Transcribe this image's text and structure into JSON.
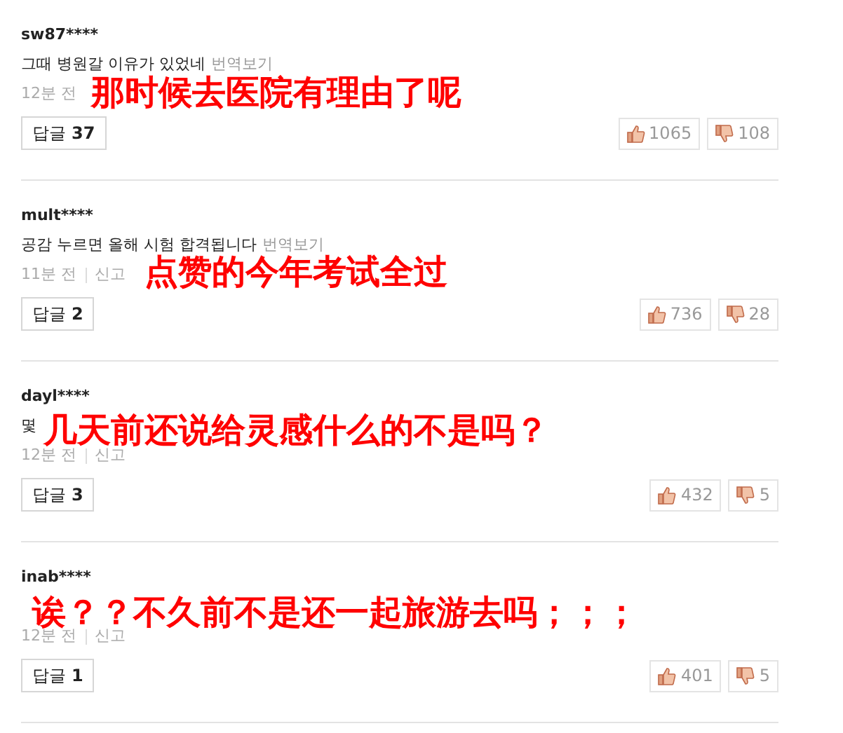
{
  "comments": [
    {
      "user": "sw87****",
      "text": "그때 병원갈 이유가 있었네",
      "translate": "번역보기",
      "time": "12분 전",
      "reply_label": "답글",
      "reply_count": "37",
      "likes": "1065",
      "dislikes": "108",
      "overlay": "那时候去医院有理由了呢"
    },
    {
      "user": "mult****",
      "text": "공감 누르면 올해 시험 합격됩니다",
      "translate": "번역보기",
      "time": "11분 전",
      "report": "신고",
      "reply_label": "답글",
      "reply_count": "2",
      "likes": "736",
      "dislikes": "28",
      "overlay": "点赞的今年考试全过"
    },
    {
      "user": "dayl****",
      "text": "몇",
      "time": "12분 전",
      "report": "신고",
      "reply_label": "답글",
      "reply_count": "3",
      "likes": "432",
      "dislikes": "5",
      "overlay": "几天前还说给灵感什么的不是吗？"
    },
    {
      "user": "inab****",
      "time": "12분 전",
      "report": "신고",
      "reply_label": "답글",
      "reply_count": "1",
      "likes": "401",
      "dislikes": "5",
      "overlay": "诶？？不久前不是还一起旅游去吗；；；"
    }
  ]
}
